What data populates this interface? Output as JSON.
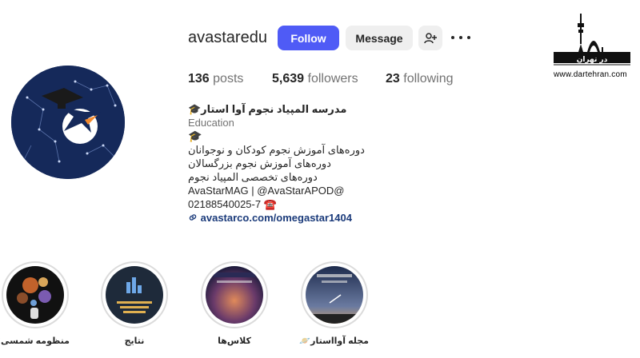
{
  "profile": {
    "username": "avastaredu",
    "follow_label": "Follow",
    "message_label": "Message",
    "add_user_icon": "person-add-icon",
    "more_icon": "more-options-icon"
  },
  "stats": {
    "posts_count": "136",
    "posts_label": "posts",
    "followers_count": "5,639",
    "followers_label": "followers",
    "following_count": "23",
    "following_label": "following"
  },
  "bio": {
    "name": "مدرسه المپیاد نجوم آوا استار🎓",
    "category": "Education",
    "emoji_line": "🎓",
    "line1": "دوره‌های آموزش نجوم کودکان و نوجوانان",
    "line2": "دوره‌های آموزش نجوم بزرگسالان",
    "line3": "دوره‌های تخصصی المپیاد نجوم",
    "mentions": "AvaStarMAG | @AvaStarAPOD@",
    "phone": "02188540025-7 ☎️",
    "link": "avastarco.com/omegastar1404"
  },
  "watermark": {
    "logo_text": "در تهران",
    "url": "www.dartehran.com"
  },
  "highlights": [
    {
      "label": "منظومه شمسی🪐"
    },
    {
      "label": "نتایج"
    },
    {
      "label": "کلاس‌ها"
    },
    {
      "label": "مجله آوااستار🪐"
    }
  ],
  "colors": {
    "follow_button": "#4f5bf6",
    "secondary_button": "#efefef",
    "avatar_bg": "#15295a",
    "link": "#1a3a7a"
  }
}
